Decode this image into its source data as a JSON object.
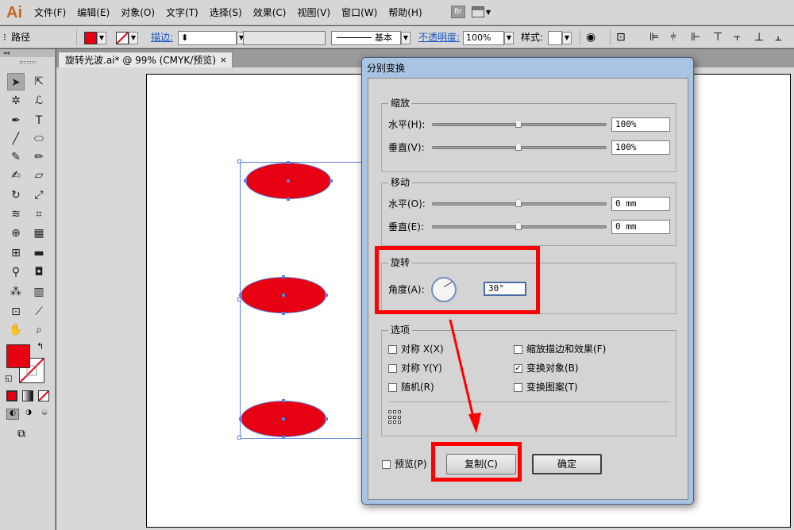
{
  "app": {
    "logo": "Ai"
  },
  "menu": [
    "文件(F)",
    "编辑(E)",
    "对象(O)",
    "文字(T)",
    "选择(S)",
    "效果(C)",
    "视图(V)",
    "窗口(W)",
    "帮助(H)"
  ],
  "bridge_label": "Br",
  "control_bar": {
    "selection_type": "路径",
    "stroke_label": "描边:",
    "stroke_profile": "基本",
    "opacity_label": "不透明度:",
    "opacity_value": "100%",
    "style_label": "样式:"
  },
  "toolpanel_header": "◂◂",
  "document": {
    "tab_title": "旋转光波.ai* @ 99% (CMYK/预览)",
    "tab_close": "×"
  },
  "colors": {
    "fill": "#e60012",
    "selection": "#5b7fdd",
    "highlight": "#ff0000"
  },
  "dialog": {
    "title": "分别变换",
    "scale": {
      "label": "缩放",
      "horizontal_label": "水平(H):",
      "horizontal_value": "100%",
      "vertical_label": "垂直(V):",
      "vertical_value": "100%"
    },
    "move": {
      "label": "移动",
      "horizontal_label": "水平(O):",
      "horizontal_value": "0 mm",
      "vertical_label": "垂直(E):",
      "vertical_value": "0 mm"
    },
    "rotate": {
      "label": "旋转",
      "angle_label": "角度(A):",
      "angle_value": "30°"
    },
    "options": {
      "label": "选项",
      "reflect_x": {
        "label": "对称 X(X)",
        "checked": false
      },
      "reflect_y": {
        "label": "对称 Y(Y)",
        "checked": false
      },
      "random": {
        "label": "随机(R)",
        "checked": false
      },
      "scale_strokes": {
        "label": "缩放描边和效果(F)",
        "checked": false
      },
      "transform_objects": {
        "label": "变换对象(B)",
        "checked": true
      },
      "transform_patterns": {
        "label": "变换图案(T)",
        "checked": false
      }
    },
    "preview": {
      "label": "预览(P)",
      "checked": false
    },
    "copy_button": "复制(C)",
    "ok_button": "确定"
  }
}
